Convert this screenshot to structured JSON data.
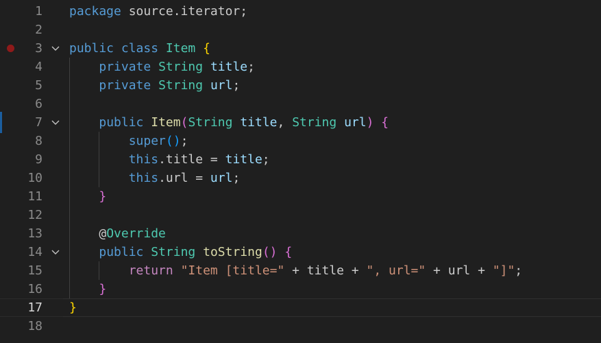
{
  "editor": {
    "active_line": 17,
    "breakpoint_line": 3,
    "line_numbers": [
      "1",
      "2",
      "3",
      "4",
      "5",
      "6",
      "7",
      "8",
      "9",
      "10",
      "11",
      "12",
      "13",
      "14",
      "15",
      "16",
      "17",
      "18"
    ],
    "fold_lines": [
      3,
      7,
      14
    ],
    "theme": {
      "background": "#1f1f1f",
      "keyword": "#569cd6",
      "type": "#4ec9b0",
      "function": "#dcdcaa",
      "variable": "#9cdcfe",
      "string": "#ce9178",
      "bracket_level1": "#ffd700",
      "bracket_level2": "#da70d6",
      "bracket_level3": "#179fff",
      "breakpoint": "#8f1a1a"
    },
    "lines": [
      [
        [
          "kw",
          "package"
        ],
        [
          "pl",
          " source.iterator;"
        ]
      ],
      [],
      [
        [
          "kw",
          "public"
        ],
        [
          "pl",
          " "
        ],
        [
          "kw",
          "class"
        ],
        [
          "pl",
          " "
        ],
        [
          "ty",
          "Item"
        ],
        [
          "pl",
          " "
        ],
        [
          "b1",
          "{"
        ]
      ],
      [
        [
          "pl",
          "    "
        ],
        [
          "kw",
          "private"
        ],
        [
          "pl",
          " "
        ],
        [
          "ty",
          "String"
        ],
        [
          "pl",
          " "
        ],
        [
          "var",
          "title"
        ],
        [
          "pl",
          ";"
        ]
      ],
      [
        [
          "pl",
          "    "
        ],
        [
          "kw",
          "private"
        ],
        [
          "pl",
          " "
        ],
        [
          "ty",
          "String"
        ],
        [
          "pl",
          " "
        ],
        [
          "var",
          "url"
        ],
        [
          "pl",
          ";"
        ]
      ],
      [],
      [
        [
          "pl",
          "    "
        ],
        [
          "kw",
          "public"
        ],
        [
          "pl",
          " "
        ],
        [
          "fn",
          "Item"
        ],
        [
          "b2",
          "("
        ],
        [
          "ty",
          "String"
        ],
        [
          "pl",
          " "
        ],
        [
          "var",
          "title"
        ],
        [
          "pl",
          ", "
        ],
        [
          "ty",
          "String"
        ],
        [
          "pl",
          " "
        ],
        [
          "var",
          "url"
        ],
        [
          "b2",
          ")"
        ],
        [
          "pl",
          " "
        ],
        [
          "b2",
          "{"
        ]
      ],
      [
        [
          "pl",
          "        "
        ],
        [
          "kw",
          "super"
        ],
        [
          "b3",
          "()"
        ],
        [
          "pl",
          ";"
        ]
      ],
      [
        [
          "pl",
          "        "
        ],
        [
          "kw",
          "this"
        ],
        [
          "pl",
          ".title = "
        ],
        [
          "var",
          "title"
        ],
        [
          "pl",
          ";"
        ]
      ],
      [
        [
          "pl",
          "        "
        ],
        [
          "kw",
          "this"
        ],
        [
          "pl",
          ".url = "
        ],
        [
          "var",
          "url"
        ],
        [
          "pl",
          ";"
        ]
      ],
      [
        [
          "pl",
          "    "
        ],
        [
          "b2",
          "}"
        ]
      ],
      [],
      [
        [
          "pl",
          "    "
        ],
        [
          "pl",
          "@"
        ],
        [
          "ty",
          "Override"
        ]
      ],
      [
        [
          "pl",
          "    "
        ],
        [
          "kw",
          "public"
        ],
        [
          "pl",
          " "
        ],
        [
          "ty",
          "String"
        ],
        [
          "pl",
          " "
        ],
        [
          "fn",
          "toString"
        ],
        [
          "b2",
          "()"
        ],
        [
          "pl",
          " "
        ],
        [
          "b2",
          "{"
        ]
      ],
      [
        [
          "pl",
          "        "
        ],
        [
          "ctl",
          "return"
        ],
        [
          "pl",
          " "
        ],
        [
          "str",
          "\"Item [title=\""
        ],
        [
          "pl",
          " + title + "
        ],
        [
          "str",
          "\", url=\""
        ],
        [
          "pl",
          " + url + "
        ],
        [
          "str",
          "\"]\""
        ],
        [
          "pl",
          ";"
        ]
      ],
      [
        [
          "pl",
          "    "
        ],
        [
          "b2",
          "}"
        ]
      ],
      [
        [
          "b1",
          "}"
        ]
      ],
      []
    ]
  }
}
